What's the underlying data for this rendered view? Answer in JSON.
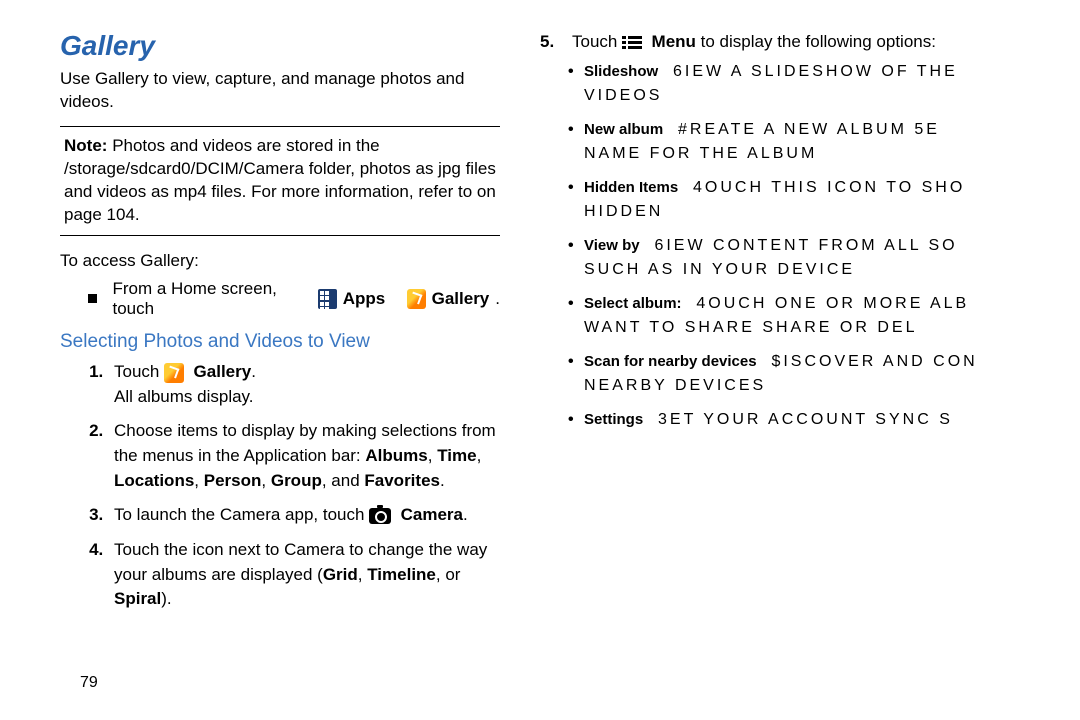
{
  "title": "Gallery",
  "intro": "Use Gallery to view, capture, and manage photos and videos.",
  "note": {
    "label": "Note:",
    "text_a": "Photos and videos are stored in the /storage/sdcard0/DCIM/Camera folder, photos as jpg files and videos as mp4 files. For more information, refer to ",
    "text_b": " on page 104."
  },
  "access_label": "To access Gallery:",
  "from_home_a": "From a Home screen, touch ",
  "apps_label": "Apps",
  "gallery_label": "Gallery",
  "period": ".",
  "subhead": "Selecting Photos and Videos to View",
  "steps": {
    "s1_a": "Touch ",
    "s1_gallery": "Gallery",
    "s1_b": ".",
    "s1_c": "All albums display.",
    "s2_a": "Choose items to display by making selections from the menus in the Application bar: ",
    "s2_b": "Albums",
    "s2_c": ", ",
    "s2_d": "Time",
    "s2_e": ", ",
    "s2_f": "Locations",
    "s2_g": ", ",
    "s2_h": "Person",
    "s2_i": ", ",
    "s2_j": "Group",
    "s2_k": ", and ",
    "s2_l": "Favorites",
    "s2_m": ".",
    "s3_a": "To launch the Camera app, touch ",
    "s3_b": "Camera",
    "s3_c": ".",
    "s4": "Touch the icon next to Camera to change the way your albums are displayed (",
    "s4_b": "Grid",
    "s4_c": ", ",
    "s4_d": "Timeline",
    "s4_e": ", or ",
    "s4_f": "Spiral",
    "s4_g": ")."
  },
  "right": {
    "step5_num": "5.",
    "step5_a": "Touch ",
    "step5_menu": "Menu",
    "step5_b": " to display the following options:",
    "opts": [
      {
        "label": "Slideshow",
        "rest": "6IEW A SLIDESHOW OF THE",
        "rest2": "VIDEOS"
      },
      {
        "label": "New album",
        "rest": "#REATE A NEW ALBUM 5E",
        "rest2": "NAME FOR THE ALBUM"
      },
      {
        "label": "Hidden Items",
        "rest": "4OUCH THIS ICON TO SHO",
        "rest2": "HIDDEN"
      },
      {
        "label": "View by",
        "rest": "6IEW CONTENT FROM ALL SO",
        "rest2": "SUCH AS IN YOUR DEVICE"
      },
      {
        "label": "Select album:",
        "rest": "4OUCH ONE OR MORE ALB",
        "rest2": "WANT TO SHARE SHARE OR DEL"
      },
      {
        "label": "Scan for nearby devices",
        "rest": "$ISCOVER AND CON",
        "rest2": "NEARBY DEVICES"
      },
      {
        "label": "Settings",
        "rest": "3ET YOUR ACCOUNT SYNC S",
        "rest2": ""
      }
    ]
  },
  "page_number": "79"
}
